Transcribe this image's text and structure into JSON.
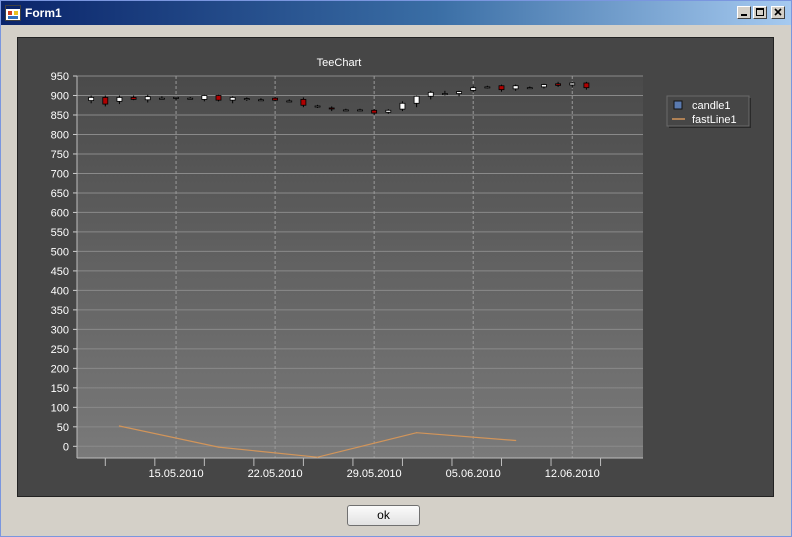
{
  "window": {
    "title": "Form1"
  },
  "title_controls": {
    "minimize": "minimize-icon",
    "maximize": "maximize-icon",
    "close": "close-icon"
  },
  "buttons": {
    "ok_label": "ok"
  },
  "colors": {
    "panel_bg": "#464646",
    "plot_top": "#4a4a4a",
    "plot_bottom": "#7a7a7a",
    "grid": "#8a8a8a",
    "text": "#ffffff",
    "candle_up": "#ffffff",
    "candle_down": "#b00000",
    "line": "#d2955a",
    "legend_candle": "#5a7ab0"
  },
  "chart_data": {
    "type": "candlestick+line",
    "title": "TeeChart",
    "ylim": [
      -30,
      950
    ],
    "yticks": [
      0,
      50,
      100,
      150,
      200,
      250,
      300,
      350,
      400,
      450,
      500,
      550,
      600,
      650,
      700,
      750,
      800,
      850,
      900,
      950
    ],
    "xlim": [
      "2010-05-08",
      "2010-06-17"
    ],
    "xticks": [
      {
        "date": "2010-05-15",
        "label": "15.05.2010"
      },
      {
        "date": "2010-05-22",
        "label": "22.05.2010"
      },
      {
        "date": "2010-05-29",
        "label": "29.05.2010"
      },
      {
        "date": "2010-06-05",
        "label": "05.06.2010"
      },
      {
        "date": "2010-06-12",
        "label": "12.06.2010"
      }
    ],
    "legend": {
      "position": "right",
      "entries": [
        {
          "name": "candle1",
          "type": "candle"
        },
        {
          "name": "fastLine1",
          "type": "line"
        }
      ]
    },
    "grid": true,
    "candles": [
      {
        "date": "2010-05-09",
        "open": 887,
        "high": 900,
        "low": 880,
        "close": 895
      },
      {
        "date": "2010-05-10",
        "open": 895,
        "high": 900,
        "low": 872,
        "close": 878
      },
      {
        "date": "2010-05-11",
        "open": 885,
        "high": 900,
        "low": 878,
        "close": 895
      },
      {
        "date": "2010-05-12",
        "open": 895,
        "high": 900,
        "low": 888,
        "close": 890
      },
      {
        "date": "2010-05-13",
        "open": 889,
        "high": 902,
        "low": 882,
        "close": 897
      },
      {
        "date": "2010-05-14",
        "open": 893,
        "high": 898,
        "low": 890,
        "close": 893
      },
      {
        "date": "2010-05-15",
        "open": 893,
        "high": 897,
        "low": 888,
        "close": 895
      },
      {
        "date": "2010-05-16",
        "open": 893,
        "high": 896,
        "low": 890,
        "close": 893
      },
      {
        "date": "2010-05-17",
        "open": 890,
        "high": 902,
        "low": 885,
        "close": 900
      },
      {
        "date": "2010-05-18",
        "open": 900,
        "high": 902,
        "low": 885,
        "close": 888
      },
      {
        "date": "2010-05-19",
        "open": 888,
        "high": 898,
        "low": 880,
        "close": 895
      },
      {
        "date": "2010-05-20",
        "open": 892,
        "high": 895,
        "low": 886,
        "close": 892
      },
      {
        "date": "2010-05-21",
        "open": 889,
        "high": 893,
        "low": 886,
        "close": 889
      },
      {
        "date": "2010-05-22",
        "open": 893,
        "high": 897,
        "low": 885,
        "close": 888
      },
      {
        "date": "2010-05-23",
        "open": 886,
        "high": 890,
        "low": 883,
        "close": 886
      },
      {
        "date": "2010-05-24",
        "open": 890,
        "high": 895,
        "low": 870,
        "close": 875
      },
      {
        "date": "2010-05-25",
        "open": 873,
        "high": 876,
        "low": 868,
        "close": 873
      },
      {
        "date": "2010-05-26",
        "open": 868,
        "high": 872,
        "low": 860,
        "close": 866
      },
      {
        "date": "2010-05-27",
        "open": 863,
        "high": 866,
        "low": 860,
        "close": 863
      },
      {
        "date": "2010-05-28",
        "open": 863,
        "high": 866,
        "low": 860,
        "close": 863
      },
      {
        "date": "2010-05-29",
        "open": 862,
        "high": 865,
        "low": 850,
        "close": 855
      },
      {
        "date": "2010-05-30",
        "open": 857,
        "high": 865,
        "low": 853,
        "close": 862
      },
      {
        "date": "2010-05-31",
        "open": 865,
        "high": 885,
        "low": 860,
        "close": 880
      },
      {
        "date": "2010-06-01",
        "open": 880,
        "high": 900,
        "low": 870,
        "close": 898
      },
      {
        "date": "2010-06-02",
        "open": 898,
        "high": 912,
        "low": 890,
        "close": 908
      },
      {
        "date": "2010-06-03",
        "open": 905,
        "high": 912,
        "low": 900,
        "close": 905
      },
      {
        "date": "2010-06-04",
        "open": 905,
        "high": 912,
        "low": 898,
        "close": 910
      },
      {
        "date": "2010-06-05",
        "open": 913,
        "high": 925,
        "low": 908,
        "close": 920
      },
      {
        "date": "2010-06-06",
        "open": 922,
        "high": 925,
        "low": 918,
        "close": 922
      },
      {
        "date": "2010-06-07",
        "open": 925,
        "high": 928,
        "low": 910,
        "close": 915
      },
      {
        "date": "2010-06-08",
        "open": 917,
        "high": 928,
        "low": 912,
        "close": 925
      },
      {
        "date": "2010-06-09",
        "open": 920,
        "high": 923,
        "low": 917,
        "close": 920
      },
      {
        "date": "2010-06-10",
        "open": 922,
        "high": 930,
        "low": 918,
        "close": 928
      },
      {
        "date": "2010-06-11",
        "open": 930,
        "high": 935,
        "low": 922,
        "close": 926
      },
      {
        "date": "2010-06-12",
        "open": 927,
        "high": 935,
        "low": 920,
        "close": 932
      },
      {
        "date": "2010-06-13",
        "open": 932,
        "high": 935,
        "low": 915,
        "close": 920
      }
    ],
    "line": [
      {
        "date": "2010-05-11",
        "value": 52
      },
      {
        "date": "2010-05-18",
        "value": -2
      },
      {
        "date": "2010-05-25",
        "value": -28
      },
      {
        "date": "2010-06-01",
        "value": 35
      },
      {
        "date": "2010-06-08",
        "value": 15
      }
    ]
  }
}
